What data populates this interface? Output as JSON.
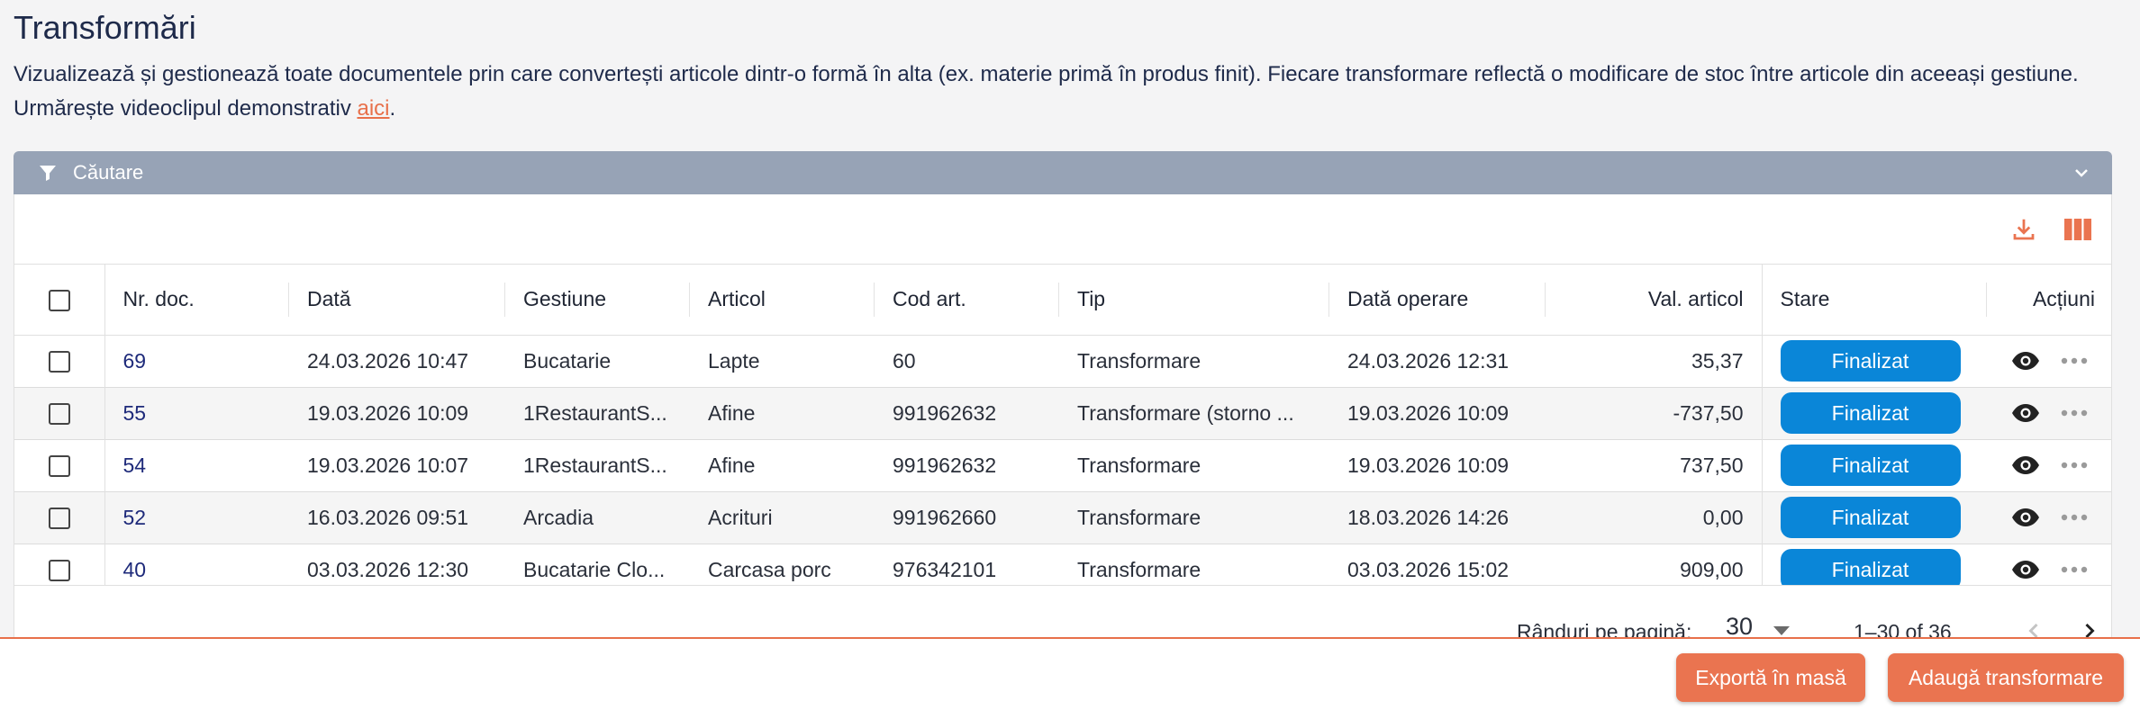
{
  "page": {
    "title": "Transformări",
    "description": "Vizualizează și gestionează toate documentele prin care convertești articole dintr-o formă în alta (ex. materie primă în produs finit). Fiecare transformare reflectă o modificare de stoc între articole din aceeași gestiune. Urmărește videoclipul demonstrativ ",
    "description_link": "aici",
    "description_end": "."
  },
  "search": {
    "label": "Căutare"
  },
  "table": {
    "columns": [
      "Nr. doc.",
      "Dată",
      "Gestiune",
      "Articol",
      "Cod art.",
      "Tip",
      "Dată operare",
      "Val. articol",
      "Stare",
      "Acțiuni"
    ],
    "rows": [
      {
        "nr": "69",
        "data": "24.03.2026 10:47",
        "gestiune": "Bucatarie",
        "articol": "Lapte",
        "cod": "60",
        "tip": "Transformare",
        "data_operare": "24.03.2026 12:31",
        "val": "35,37",
        "stare": "Finalizat"
      },
      {
        "nr": "55",
        "data": "19.03.2026 10:09",
        "gestiune": "1RestaurantS...",
        "articol": "Afine",
        "cod": "991962632",
        "tip": "Transformare (storno ...",
        "data_operare": "19.03.2026 10:09",
        "val": "-737,50",
        "stare": "Finalizat"
      },
      {
        "nr": "54",
        "data": "19.03.2026 10:07",
        "gestiune": "1RestaurantS...",
        "articol": "Afine",
        "cod": "991962632",
        "tip": "Transformare",
        "data_operare": "19.03.2026 10:09",
        "val": "737,50",
        "stare": "Finalizat"
      },
      {
        "nr": "52",
        "data": "16.03.2026 09:51",
        "gestiune": "Arcadia",
        "articol": "Acrituri",
        "cod": "991962660",
        "tip": "Transformare",
        "data_operare": "18.03.2026 14:26",
        "val": "0,00",
        "stare": "Finalizat"
      },
      {
        "nr": "40",
        "data": "03.03.2026 12:30",
        "gestiune": "Bucatarie Clo...",
        "articol": "Carcasa porc",
        "cod": "976342101",
        "tip": "Transformare",
        "data_operare": "03.03.2026 15:02",
        "val": "909,00",
        "stare": "Finalizat"
      }
    ]
  },
  "pagination": {
    "rows_label": "Rânduri pe pagină:",
    "rows_per_page": "30",
    "range": "1–30 of 36"
  },
  "footer": {
    "export_label": "Exportă în masă",
    "add_label": "Adaugă transformare"
  },
  "colors": {
    "accent": "#ea7450",
    "status_badge": "#0a86d8",
    "search_bar": "#97a3b6",
    "link": "#e8704a"
  },
  "icons": [
    "filter-icon",
    "chevron-down-icon",
    "download-icon",
    "columns-icon",
    "eye-icon",
    "more-horizontal-icon",
    "chevron-left-icon",
    "chevron-right-icon"
  ]
}
